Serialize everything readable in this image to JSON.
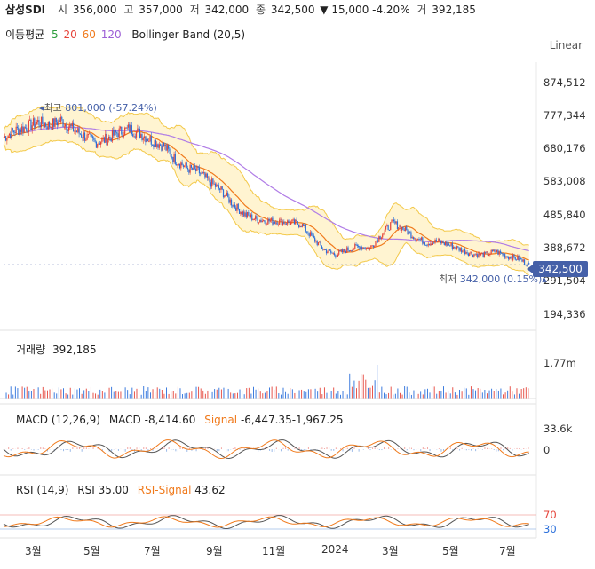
{
  "header": {
    "name": "삼성SDI",
    "open_label": "시",
    "open": "356,000",
    "high_label": "고",
    "high": "357,000",
    "low_label": "저",
    "low": "342,000",
    "close_label": "종",
    "close": "342,500",
    "change": "▼ 15,000 -4.20%",
    "volume_label": "거",
    "volume": "392,185"
  },
  "indicators": {
    "ma_label": "이동평균",
    "ma_periods": [
      {
        "value": "5",
        "color": "#2e9e3e"
      },
      {
        "value": "20",
        "color": "#e5443a"
      },
      {
        "value": "60",
        "color": "#f07a1c"
      },
      {
        "value": "120",
        "color": "#9c5fd6"
      }
    ],
    "bollinger": "Bollinger Band (20,5)"
  },
  "scale_label": "Linear",
  "colors": {
    "up": "#e5443a",
    "down": "#2a6fdb",
    "band_fill": "#fff4d1",
    "band_line": "#f3c94a",
    "ma20": "#f07a1c",
    "ma120": "#b07ce6"
  },
  "chart_data": [
    {
      "type": "candlestick",
      "title": "삼성SDI",
      "y_ticks": [
        "874,512",
        "777,344",
        "680,176",
        "583,008",
        "485,840",
        "388,672",
        "291,504",
        "194,336"
      ],
      "ylim": [
        180000,
        910000
      ],
      "x_ticks": [
        "3월",
        "5월",
        "7월",
        "9월",
        "11월",
        "2024",
        "3월",
        "5월",
        "7월"
      ],
      "last_price": "342,500",
      "annotations": {
        "high": {
          "label": "최고",
          "value": "801,000 (-57.24%)",
          "price": 801000
        },
        "low": {
          "label": "최저",
          "value": "342,000 (0.15%)",
          "price": 342000
        }
      },
      "price_path": [
        [
          0,
          715000
        ],
        [
          10,
          735000
        ],
        [
          20,
          745000
        ],
        [
          30,
          760000
        ],
        [
          40,
          750000
        ],
        [
          50,
          765000
        ],
        [
          60,
          740000
        ],
        [
          70,
          720000
        ],
        [
          80,
          700000
        ],
        [
          90,
          710000
        ],
        [
          100,
          730000
        ],
        [
          110,
          740000
        ],
        [
          120,
          725000
        ],
        [
          130,
          705000
        ],
        [
          140,
          690000
        ],
        [
          150,
          650000
        ],
        [
          160,
          625000
        ],
        [
          170,
          615000
        ],
        [
          180,
          585000
        ],
        [
          190,
          560000
        ],
        [
          200,
          520000
        ],
        [
          210,
          490000
        ],
        [
          220,
          475000
        ],
        [
          230,
          470000
        ],
        [
          240,
          468000
        ],
        [
          250,
          465000
        ],
        [
          260,
          460000
        ],
        [
          270,
          420000
        ],
        [
          280,
          385000
        ],
        [
          290,
          370000
        ],
        [
          300,
          385000
        ],
        [
          310,
          395000
        ],
        [
          320,
          390000
        ],
        [
          330,
          430000
        ],
        [
          340,
          465000
        ],
        [
          350,
          445000
        ],
        [
          360,
          420000
        ],
        [
          370,
          405000
        ],
        [
          380,
          410000
        ],
        [
          390,
          398000
        ],
        [
          400,
          385000
        ],
        [
          410,
          372000
        ],
        [
          420,
          370000
        ],
        [
          430,
          380000
        ],
        [
          440,
          366000
        ],
        [
          450,
          358000
        ],
        [
          458,
          342500
        ]
      ]
    },
    {
      "type": "bar",
      "title": "거래량",
      "value": "392,185",
      "y_ticks": [
        "1.77m"
      ]
    },
    {
      "type": "line",
      "title": "MACD",
      "params": "(12,26,9)",
      "macd_label": "MACD",
      "macd": "-8,414.60",
      "signal_label": "Signal",
      "signal": "-6,447.35",
      "hist": "-1,967.25",
      "y_ticks": [
        "33.6k",
        "0"
      ]
    },
    {
      "type": "line",
      "title": "RSI",
      "params": "(14,9)",
      "rsi_label": "RSI",
      "rsi": "35.00",
      "signal_label": "RSI-Signal",
      "signal": "43.62",
      "y_ticks": [
        "70",
        "30"
      ]
    }
  ]
}
